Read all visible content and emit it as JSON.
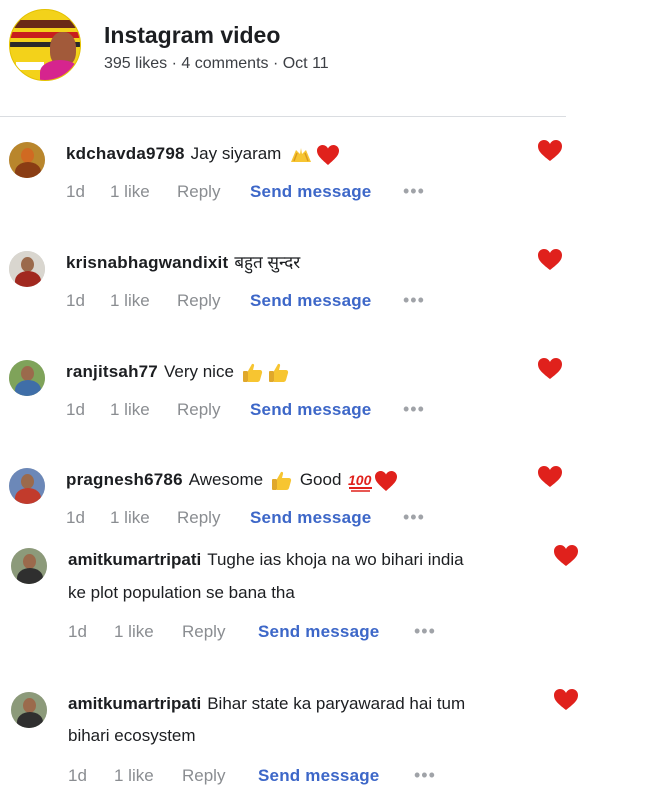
{
  "post": {
    "title": "Instagram video",
    "meta": "395 likes · 4 comments · Oct 11",
    "thumbnail_icon": "video-thumbnail"
  },
  "colors": {
    "link": "#3d67c8",
    "heart": "#e0211c",
    "muted": "#8a8d91",
    "text": "#1c1e21"
  },
  "comments": [
    {
      "username": "kdchavda9798",
      "text": "Jay siyaram",
      "emoji": [
        "raised-hands",
        "red-heart"
      ],
      "age": "1d",
      "likes": "1 like",
      "reply": "Reply",
      "send": "Send message",
      "more": "•••",
      "liked": true
    },
    {
      "username": "krisnabhagwandixit",
      "text": "बहुत सुन्दर",
      "emoji": [],
      "age": "1d",
      "likes": "1 like",
      "reply": "Reply",
      "send": "Send message",
      "more": "•••",
      "liked": true
    },
    {
      "username": "ranjitsah77",
      "text": "Very nice",
      "emoji": [
        "thumbs-up",
        "thumbs-up"
      ],
      "age": "1d",
      "likes": "1 like",
      "reply": "Reply",
      "send": "Send message",
      "more": "•••",
      "liked": true
    },
    {
      "username": "pragnesh6786",
      "text_a": "Awesome",
      "text_b": "Good",
      "emoji": [
        "thumbs-up",
        "hundred",
        "red-heart"
      ],
      "age": "1d",
      "likes": "1 like",
      "reply": "Reply",
      "send": "Send message",
      "more": "•••",
      "liked": true
    },
    {
      "username": "amitkumartripati",
      "text": "Tughe ias khoja na wo bihari india",
      "text_line2": "ke plot population se bana tha",
      "age": "1d",
      "likes": "1 like",
      "reply": "Reply",
      "send": "Send message",
      "more": "•••",
      "liked": true
    },
    {
      "username": "amitkumartripati",
      "text": "Bihar state ka paryawarad hai tum",
      "text_line2": "bihari ecosystem",
      "age": "1d",
      "likes": "1 like",
      "reply": "Reply",
      "send": "Send message",
      "more": "•••",
      "liked": true
    }
  ]
}
